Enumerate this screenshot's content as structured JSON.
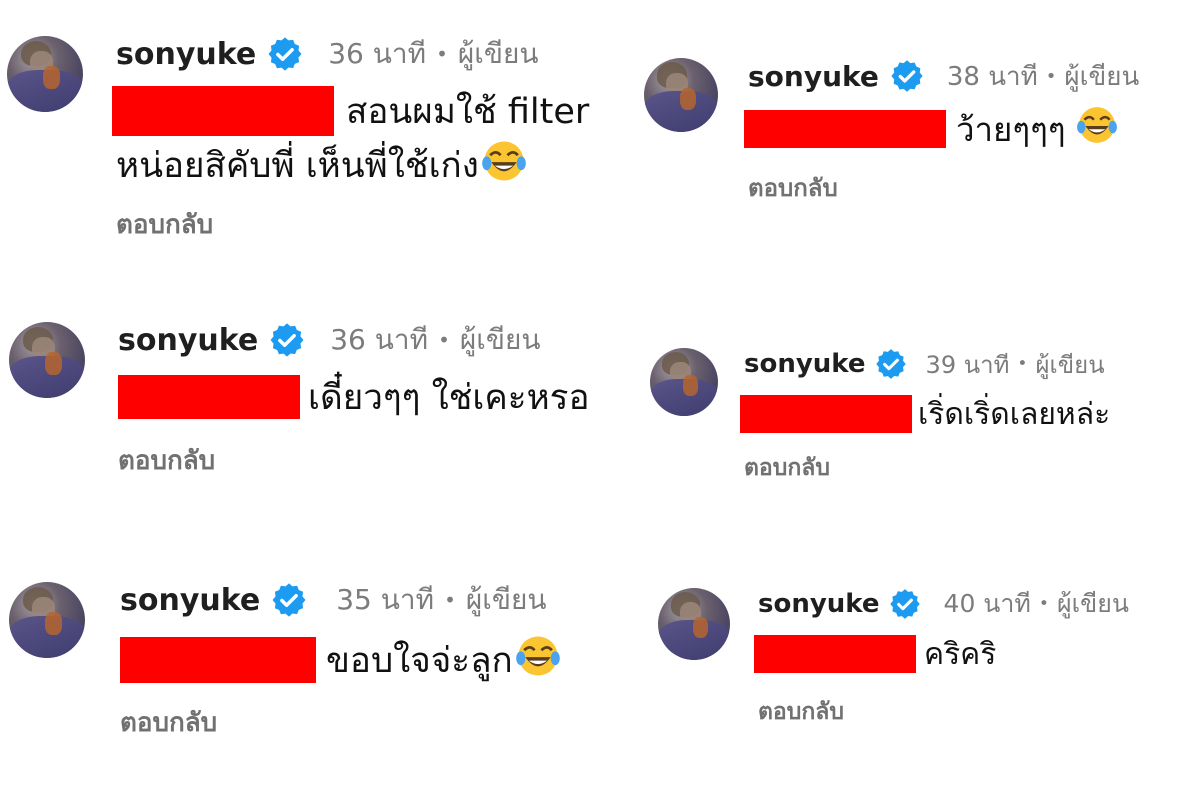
{
  "comments": [
    {
      "username": "sonyuke",
      "time": "36 นาที",
      "role": "ผู้เขียน",
      "text_line1": "สอนผมใช้ filter",
      "text_line2": "หน่อยสิคับพี่ เห็นพี่ใช้เก่ง",
      "has_emoji": true,
      "reply_label": "ตอบกลับ"
    },
    {
      "username": "sonyuke",
      "time": "38 นาที",
      "role": "ผู้เขียน",
      "text_line1": "ว้ายๆๆๆ",
      "has_emoji": true,
      "reply_label": "ตอบกลับ"
    },
    {
      "username": "sonyuke",
      "time": "36 นาที",
      "role": "ผู้เขียน",
      "text_line1": "เดี๋ยวๆๆ ใช่เคะหรอ",
      "has_emoji": false,
      "reply_label": "ตอบกลับ"
    },
    {
      "username": "sonyuke",
      "time": "39 นาที",
      "role": "ผู้เขียน",
      "text_line1": "เริ่ดเริ่ดเลยหล่ะ",
      "has_emoji": false,
      "reply_label": "ตอบกลับ"
    },
    {
      "username": "sonyuke",
      "time": "35 นาที",
      "role": "ผู้เขียน",
      "text_line1": "ขอบใจจ่ะลูก",
      "has_emoji": true,
      "reply_label": "ตอบกลับ"
    },
    {
      "username": "sonyuke",
      "time": "40 นาที",
      "role": "ผู้เขียน",
      "text_line1": "คริคริ",
      "has_emoji": false,
      "reply_label": "ตอบกลับ"
    }
  ],
  "colors": {
    "redaction": "#ff0000",
    "verified_badge": "#1d9bf0",
    "meta_text": "#7c7c7c",
    "reply_text": "#717171"
  },
  "icons": {
    "verified": "verified-badge-icon",
    "emoji": "face-with-tears-of-joy-icon"
  }
}
